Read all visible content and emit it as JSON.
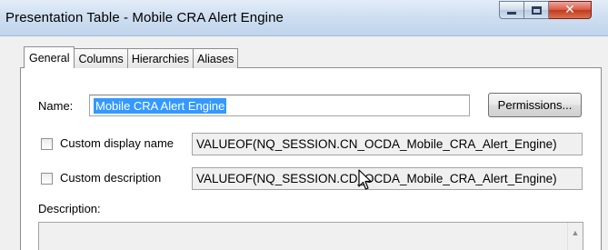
{
  "window": {
    "title": "Presentation Table - Mobile CRA Alert Engine"
  },
  "tabs": [
    {
      "label": "General",
      "active": true
    },
    {
      "label": "Columns",
      "active": false
    },
    {
      "label": "Hierarchies",
      "active": false
    },
    {
      "label": "Aliases",
      "active": false
    }
  ],
  "general": {
    "name_label": "Name:",
    "name_value": "Mobile CRA Alert Engine",
    "permissions_label": "Permissions...",
    "custom_display_name": {
      "label": "Custom display name",
      "checked": false,
      "value": "VALUEOF(NQ_SESSION.CN_OCDA_Mobile_CRA_Alert_Engine)"
    },
    "custom_description": {
      "label": "Custom description",
      "checked": false,
      "value": "VALUEOF(NQ_SESSION.CD_OCDA_Mobile_CRA_Alert_Engine)"
    },
    "description_label": "Description:",
    "description_value": ""
  },
  "icons": {
    "minimize": "minimize-icon",
    "maximize": "maximize-icon",
    "close": "close-icon",
    "scroll_up": "scroll-up-arrow-icon",
    "cursor": "mouse-pointer-icon"
  },
  "colors": {
    "selection": "#3399ff",
    "close_button": "#c9452a",
    "titlebar": "#cfdff1"
  }
}
